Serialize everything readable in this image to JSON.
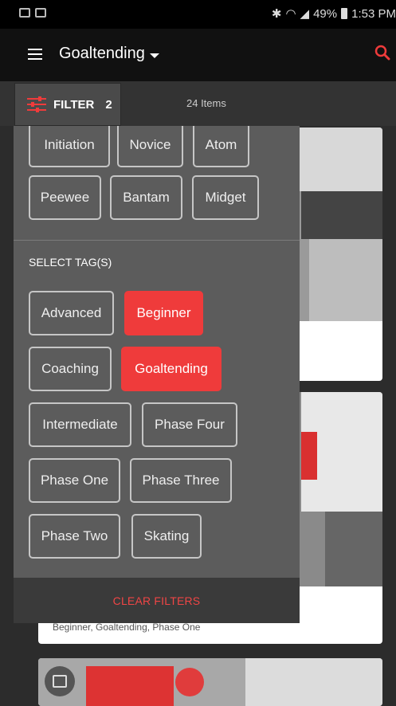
{
  "status_bar": {
    "battery_percent": "49%",
    "time": "1:53 PM"
  },
  "app_bar": {
    "title": "Goaltending",
    "icons": {
      "menu": "menu-icon",
      "search": "search-icon",
      "dropdown": "chevron-down-icon"
    },
    "accent_color": "#ef3b3b"
  },
  "toolbar": {
    "filter_label": "FILTER",
    "filter_count": "2",
    "item_count": "24 Items"
  },
  "filter_panel": {
    "level_chips": [
      {
        "label": "Initiation",
        "selected": false
      },
      {
        "label": "Novice",
        "selected": false
      },
      {
        "label": "Atom",
        "selected": false
      },
      {
        "label": "Peewee",
        "selected": false
      },
      {
        "label": "Bantam",
        "selected": false
      },
      {
        "label": "Midget",
        "selected": false
      }
    ],
    "tags_heading": "SELECT TAG(S)",
    "tag_chips": [
      {
        "label": "Advanced",
        "selected": false
      },
      {
        "label": "Beginner",
        "selected": true
      },
      {
        "label": "Coaching",
        "selected": false
      },
      {
        "label": "Goaltending",
        "selected": true
      },
      {
        "label": "Intermediate",
        "selected": false
      },
      {
        "label": "Phase Four",
        "selected": false
      },
      {
        "label": "Phase One",
        "selected": false
      },
      {
        "label": "Phase Three",
        "selected": false
      },
      {
        "label": "Phase Two",
        "selected": false
      },
      {
        "label": "Skating",
        "selected": false
      }
    ],
    "clear_label": "CLEAR FILTERS"
  },
  "cards": [
    {
      "tags": ""
    },
    {
      "tags": "Beginner, Goaltending, Phase One"
    },
    {
      "tags": ""
    }
  ]
}
